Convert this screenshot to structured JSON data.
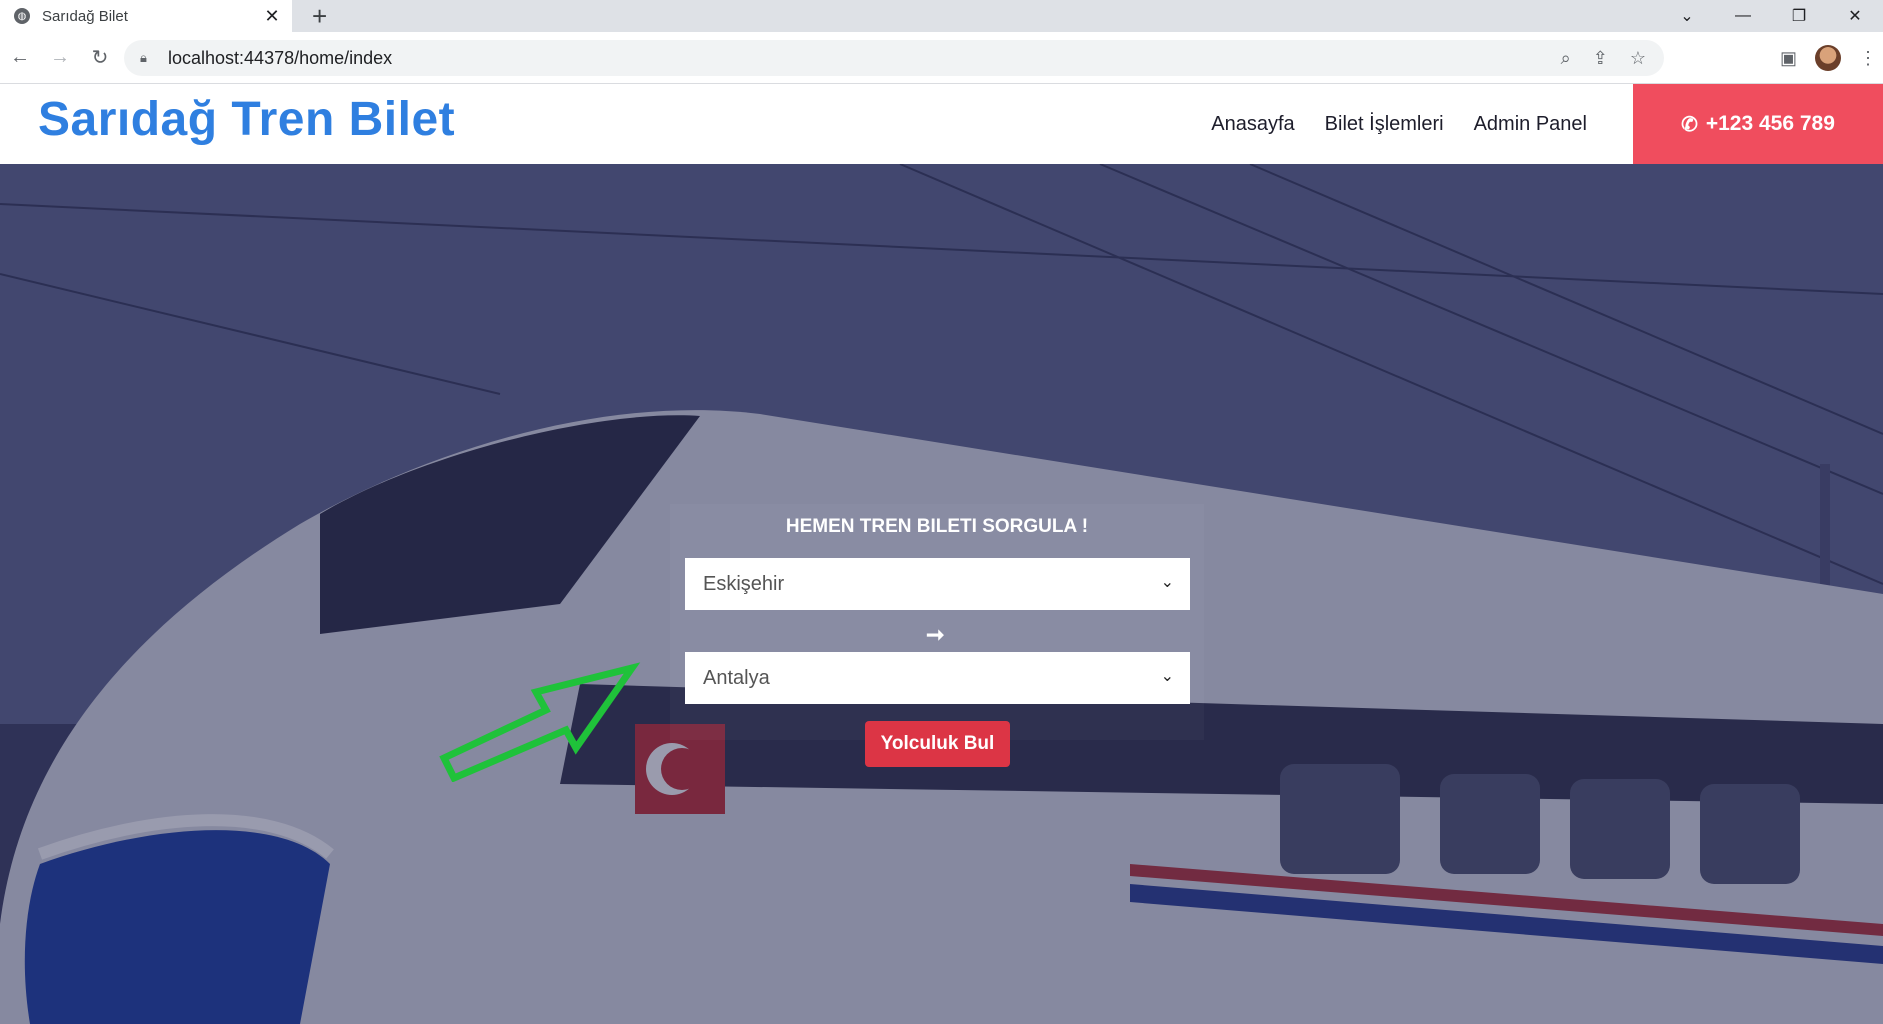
{
  "browser": {
    "tab_title": "Sarıdağ Bilet",
    "url": "localhost:44378/home/index"
  },
  "header": {
    "brand": "Sarıdağ Tren Bilet",
    "nav": [
      "Anasayfa",
      "Bilet İşlemleri",
      "Admin Panel"
    ],
    "phone": "+123 456 789"
  },
  "search": {
    "title": "HEMEN TREN BILETI SORGULA !",
    "from_value": "Eskişehir",
    "to_value": "Antalya",
    "swap_symbol": "➞",
    "submit_label": "Yolculuk Bul"
  },
  "colors": {
    "brand": "#2f7fe0",
    "phone_bg": "#f04d5e",
    "button": "#dc3545",
    "annotation_arrow": "#1fc23a"
  }
}
